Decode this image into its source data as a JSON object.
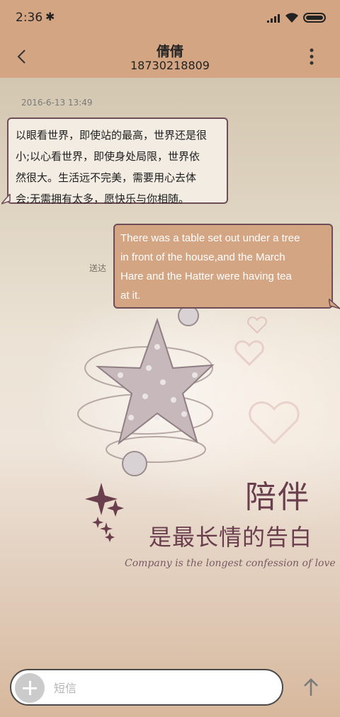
{
  "status_bar": {
    "time": "2:36",
    "icons": [
      "bluetooth-icon",
      "signal-icon",
      "wifi-icon",
      "battery-icon"
    ]
  },
  "header": {
    "contact_name": "倩倩",
    "contact_number": "18730218809"
  },
  "conversation": {
    "timestamp": "2016-6-13 13:49",
    "messages": [
      {
        "direction": "incoming",
        "lines": [
          "以眼看世界，即使站的最高，世界还是很",
          "小;以心看世界，即使身处局限，世界依",
          "然很大。生活远不完美，需要用心去体",
          "会;无需拥有太多，愿快乐与你相随。"
        ]
      },
      {
        "direction": "outgoing",
        "status": "送达",
        "lines": [
          "There was a table set out under a tree",
          "in front of the house,and the March",
          "Hare and the Hatter were having tea",
          "at it."
        ]
      }
    ]
  },
  "wallpaper": {
    "title": "陪伴",
    "subtitle": "是最长情的告白",
    "tagline": "Company is the longest confession of love"
  },
  "composer": {
    "placeholder": "短信",
    "value": ""
  },
  "colors": {
    "accent": "#d4a582",
    "bubble_border": "#6e4d57",
    "poster_text": "#6b3e4e"
  }
}
